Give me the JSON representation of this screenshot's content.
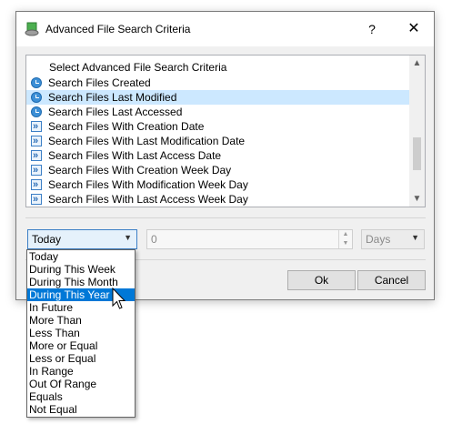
{
  "window": {
    "title": "Advanced File Search Criteria",
    "help_glyph": "?",
    "close_glyph": "✕"
  },
  "criteria_list": {
    "header": "Select Advanced File Search Criteria",
    "items": [
      {
        "label": "Search Files Created",
        "icon": "clock-icon"
      },
      {
        "label": "Search Files Last Modified",
        "icon": "clock-icon",
        "selected": true
      },
      {
        "label": "Search Files Last Accessed",
        "icon": "clock-icon"
      },
      {
        "label": "Search Files With Creation Date",
        "icon": "date-arrow-icon"
      },
      {
        "label": "Search Files With Last Modification Date",
        "icon": "date-arrow-icon"
      },
      {
        "label": "Search Files With Last Access Date",
        "icon": "date-arrow-icon"
      },
      {
        "label": "Search Files With Creation Week Day",
        "icon": "date-arrow-icon"
      },
      {
        "label": "Search Files With Modification Week Day",
        "icon": "date-arrow-icon"
      },
      {
        "label": "Search Files With Last Access Week Day",
        "icon": "date-arrow-icon"
      }
    ],
    "scroll_up_glyph": "▲",
    "scroll_down_glyph": "▼"
  },
  "condition": {
    "selected": "Today",
    "arrow_glyph": "▼",
    "options": [
      "Today",
      "During This Week",
      "During This Month",
      "During This Year",
      "In Future",
      "More Than",
      "Less Than",
      "More or Equal",
      "Less or Equal",
      "In Range",
      "Out Of Range",
      "Equals",
      "Not Equal"
    ],
    "highlighted_index": 3
  },
  "amount": {
    "value": "0",
    "up_glyph": "▲",
    "down_glyph": "▼"
  },
  "unit": {
    "selected": "Days",
    "arrow_glyph": "▼"
  },
  "buttons": {
    "ok": "Ok",
    "cancel": "Cancel"
  },
  "colors": {
    "selection": "#cce8ff",
    "highlight": "#0078d7"
  }
}
